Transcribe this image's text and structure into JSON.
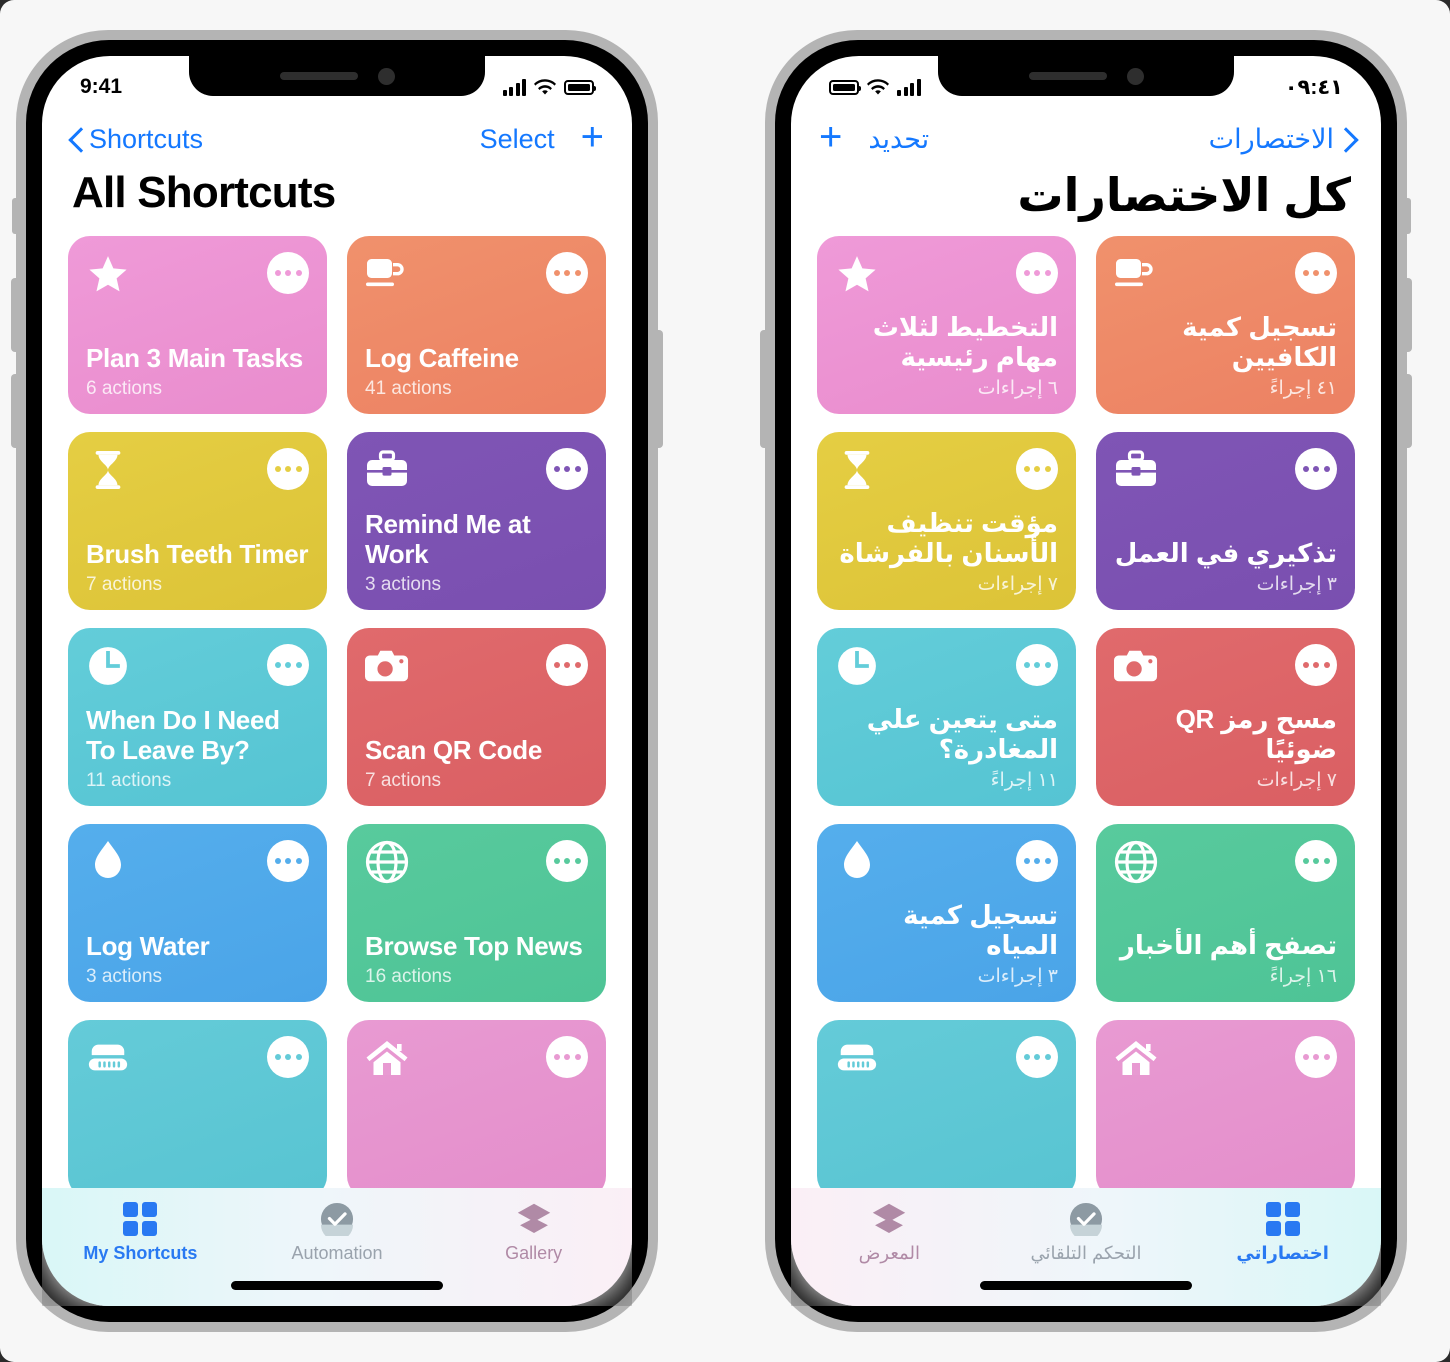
{
  "phones": {
    "left": {
      "lang": "en",
      "dir": "ltr",
      "status": {
        "time": "9:41"
      },
      "nav": {
        "back_label": "Shortcuts",
        "select_label": "Select",
        "add_label": "+"
      },
      "title": "All Shortcuts",
      "cards": [
        {
          "title": "Plan 3 Main Tasks",
          "sub": "6 actions",
          "icon": "star-icon",
          "color_from": "#ef9ad8",
          "color_to": "#e98ccd"
        },
        {
          "title": "Log Caffeine",
          "sub": "41 actions",
          "icon": "coffee-cup-icon",
          "color_from": "#f0916c",
          "color_to": "#ec8163"
        },
        {
          "title": "Brush Teeth Timer",
          "sub": "7 actions",
          "icon": "hourglass-icon",
          "color_from": "#e5ce43",
          "color_to": "#dcc337"
        },
        {
          "title": "Remind Me at Work",
          "sub": "3 actions",
          "icon": "briefcase-icon",
          "color_from": "#7f55b5",
          "color_to": "#7a4fb0"
        },
        {
          "title": "When Do I Need To Leave By?",
          "sub": "11 actions",
          "icon": "clock-icon",
          "color_from": "#63cdd9",
          "color_to": "#55c4d3"
        },
        {
          "title": "Scan QR Code",
          "sub": "7 actions",
          "icon": "camera-icon",
          "color_from": "#e06a6c",
          "color_to": "#da5f63"
        },
        {
          "title": "Log Water",
          "sub": "3 actions",
          "icon": "droplet-icon",
          "color_from": "#55aeec",
          "color_to": "#4aa4e8"
        },
        {
          "title": "Browse Top News",
          "sub": "16 actions",
          "icon": "globe-icon",
          "color_from": "#58ca9d",
          "color_to": "#4ec496"
        },
        {
          "title": "",
          "sub": "",
          "icon": "shower-icon",
          "color_from": "#64cbd8",
          "color_to": "#58c4d2"
        },
        {
          "title": "",
          "sub": "",
          "icon": "home-icon",
          "color_from": "#e89ad2",
          "color_to": "#e48ecb"
        }
      ],
      "tabs": [
        {
          "label": "My Shortcuts",
          "icon": "grid-icon",
          "state": "active"
        },
        {
          "label": "Automation",
          "icon": "automation-icon",
          "state": "inactive"
        },
        {
          "label": "Gallery",
          "icon": "layers-icon",
          "state": "inactive"
        }
      ]
    },
    "right": {
      "lang": "ar",
      "dir": "rtl",
      "status": {
        "time": "٠٩:٤١"
      },
      "nav": {
        "back_label": "الاختصارات",
        "select_label": "تحديد",
        "add_label": "+"
      },
      "title": "كل الاختصارات",
      "cards": [
        {
          "title": "تسجيل كمية الكافيين",
          "sub": "٤١ إجراءً",
          "icon": "coffee-cup-icon",
          "color_from": "#f0916c",
          "color_to": "#ec8163"
        },
        {
          "title": "التخطيط لثلاث مهام رئيسية",
          "sub": "٦ إجراءات",
          "icon": "star-icon",
          "color_from": "#ef9ad8",
          "color_to": "#e98ccd"
        },
        {
          "title": "تذكيري في العمل",
          "sub": "٣ إجراءات",
          "icon": "briefcase-icon",
          "color_from": "#7f55b5",
          "color_to": "#7a4fb0"
        },
        {
          "title": "مؤقت تنظيف الأسنان بالفرشاة",
          "sub": "٧ إجراءات",
          "icon": "hourglass-icon",
          "color_from": "#e5ce43",
          "color_to": "#dcc337"
        },
        {
          "title": "مسح رمز QR ضوئيًا",
          "sub": "٧ إجراءات",
          "icon": "camera-icon",
          "color_from": "#e06a6c",
          "color_to": "#da5f63"
        },
        {
          "title": "متى يتعين علي المغادرة؟",
          "sub": "١١ إجراءً",
          "icon": "clock-icon",
          "color_from": "#63cdd9",
          "color_to": "#55c4d3"
        },
        {
          "title": "تصفح أهم الأخبار",
          "sub": "١٦ إجراءً",
          "icon": "globe-icon",
          "color_from": "#58ca9d",
          "color_to": "#4ec496"
        },
        {
          "title": "تسجيل كمية المياه",
          "sub": "٣ إجراءات",
          "icon": "droplet-icon",
          "color_from": "#55aeec",
          "color_to": "#4aa4e8"
        },
        {
          "title": "",
          "sub": "",
          "icon": "home-icon",
          "color_from": "#e89ad2",
          "color_to": "#e48ecb"
        },
        {
          "title": "",
          "sub": "",
          "icon": "shower-icon",
          "color_from": "#64cbd8",
          "color_to": "#58c4d2"
        }
      ],
      "tabs": [
        {
          "label": "اختصاراتي",
          "icon": "grid-icon",
          "state": "active"
        },
        {
          "label": "التحكم التلقائي",
          "icon": "automation-icon",
          "state": "inactive"
        },
        {
          "label": "المعرض",
          "icon": "layers-icon",
          "state": "inactive"
        }
      ]
    }
  },
  "colors": {
    "accent": "#1478ff",
    "tab_active": "#2979f2",
    "tab_inactive": "#9aa3ad",
    "tab_gallery": "#b08aa6"
  }
}
